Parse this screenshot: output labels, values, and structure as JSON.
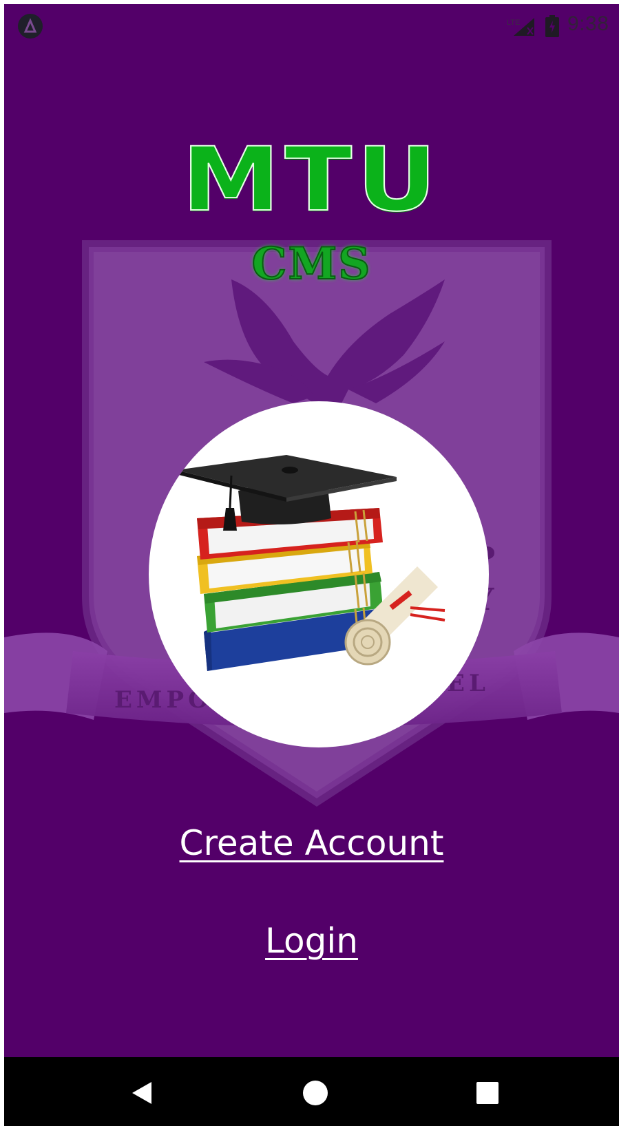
{
  "status_bar": {
    "time": "9:38",
    "network_label": "LTE",
    "icons": [
      "app-notification-icon",
      "signal-icon",
      "battery-icon"
    ]
  },
  "logo": {
    "title": "MTU",
    "subtitle": "CMS"
  },
  "crest": {
    "banner_text": "EMPOWERED TO EXCEL"
  },
  "hero": {
    "image": "graduation-cap-books-diploma"
  },
  "actions": {
    "create_account": "Create Account",
    "login": "Login"
  },
  "nav_bar": {
    "icons": [
      "back-icon",
      "home-icon",
      "recents-icon"
    ]
  },
  "colors": {
    "background": "#530069",
    "logo_green": "#0bb21a",
    "link_text": "#ffffff",
    "nav_bar": "#000000"
  }
}
